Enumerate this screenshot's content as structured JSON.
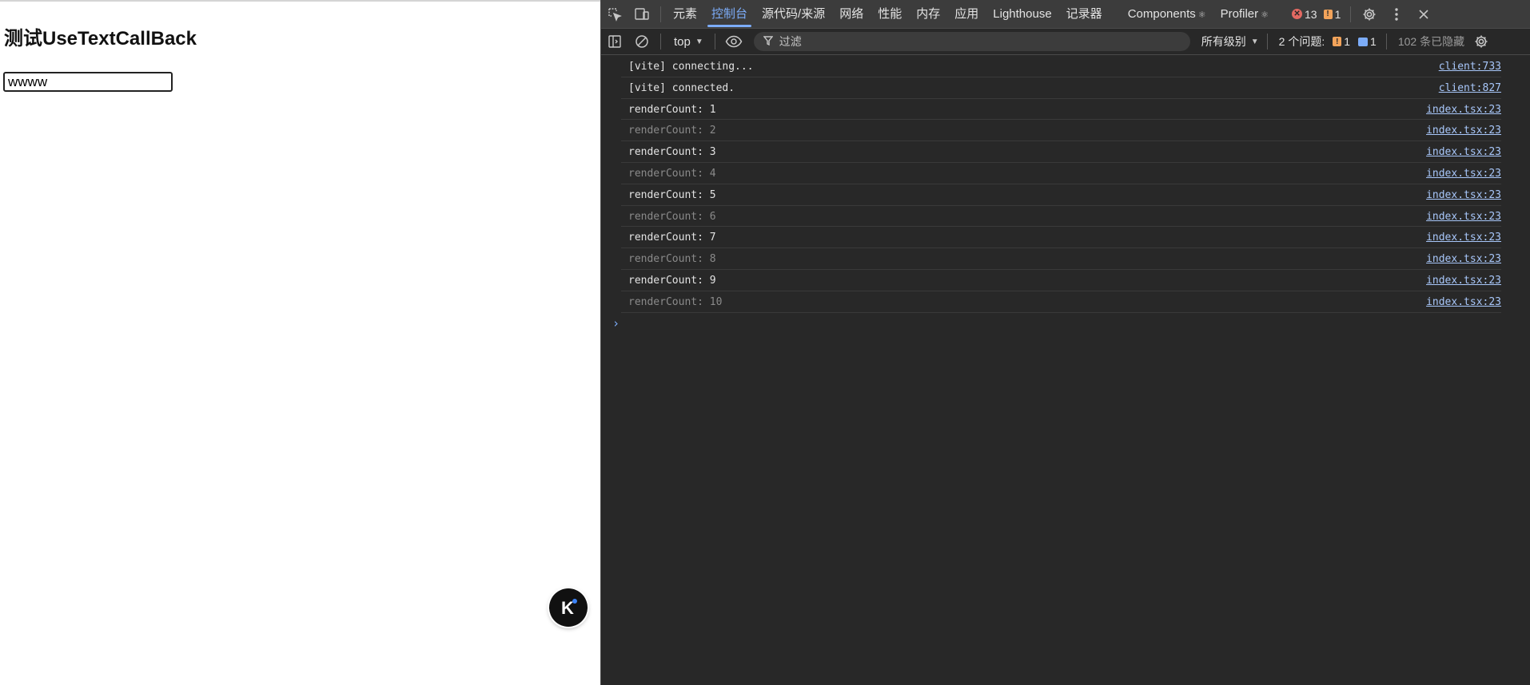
{
  "page": {
    "title": "测试UseTextCallBack",
    "input_value": "wwww",
    "badge_letter": "K"
  },
  "devtools": {
    "tabs": [
      {
        "label": "元素",
        "active": false
      },
      {
        "label": "控制台",
        "active": true
      },
      {
        "label": "源代码/来源",
        "active": false
      },
      {
        "label": "网络",
        "active": false
      },
      {
        "label": "性能",
        "active": false
      },
      {
        "label": "内存",
        "active": false
      },
      {
        "label": "应用",
        "active": false
      },
      {
        "label": "Lighthouse",
        "active": false
      },
      {
        "label": "记录器",
        "active": false
      },
      {
        "label": "Components",
        "active": false
      },
      {
        "label": "Profiler",
        "active": false
      }
    ],
    "tab_symbol": "⚛",
    "error_count": "13",
    "warning_count": "1",
    "toolbar": {
      "context": "top",
      "filter_placeholder": "过滤",
      "levels": "所有级别",
      "issues_label": "2 个问题:",
      "issues_warning": "1",
      "issues_info": "1",
      "hidden_count": "102 条已隐藏"
    },
    "console_logs": [
      {
        "message": "[vite] connecting...",
        "source": "client:733",
        "dim": false
      },
      {
        "message": "[vite] connected.",
        "source": "client:827",
        "dim": false
      },
      {
        "message": "renderCount: 1",
        "source": "index.tsx:23",
        "dim": false
      },
      {
        "message": "renderCount: 2",
        "source": "index.tsx:23",
        "dim": true
      },
      {
        "message": "renderCount: 3",
        "source": "index.tsx:23",
        "dim": false
      },
      {
        "message": "renderCount: 4",
        "source": "index.tsx:23",
        "dim": true
      },
      {
        "message": "renderCount: 5",
        "source": "index.tsx:23",
        "dim": false
      },
      {
        "message": "renderCount: 6",
        "source": "index.tsx:23",
        "dim": true
      },
      {
        "message": "renderCount: 7",
        "source": "index.tsx:23",
        "dim": false
      },
      {
        "message": "renderCount: 8",
        "source": "index.tsx:23",
        "dim": true
      },
      {
        "message": "renderCount: 9",
        "source": "index.tsx:23",
        "dim": false
      },
      {
        "message": "renderCount: 10",
        "source": "index.tsx:23",
        "dim": true
      }
    ],
    "prompt_symbol": "›",
    "colors": {
      "accent": "#7cacf8",
      "link": "#a8c7fa",
      "panel_bg": "#282828",
      "tabbar_bg": "#3c3c3c",
      "error": "#e46962",
      "warning": "#f2a35a"
    },
    "icons": [
      "inspect-element-icon",
      "device-toolbar-icon",
      "sidebar-toggle-icon",
      "clear-console-icon",
      "eye-icon",
      "filter-icon",
      "gear-icon",
      "more-vertical-icon",
      "close-icon"
    ]
  }
}
